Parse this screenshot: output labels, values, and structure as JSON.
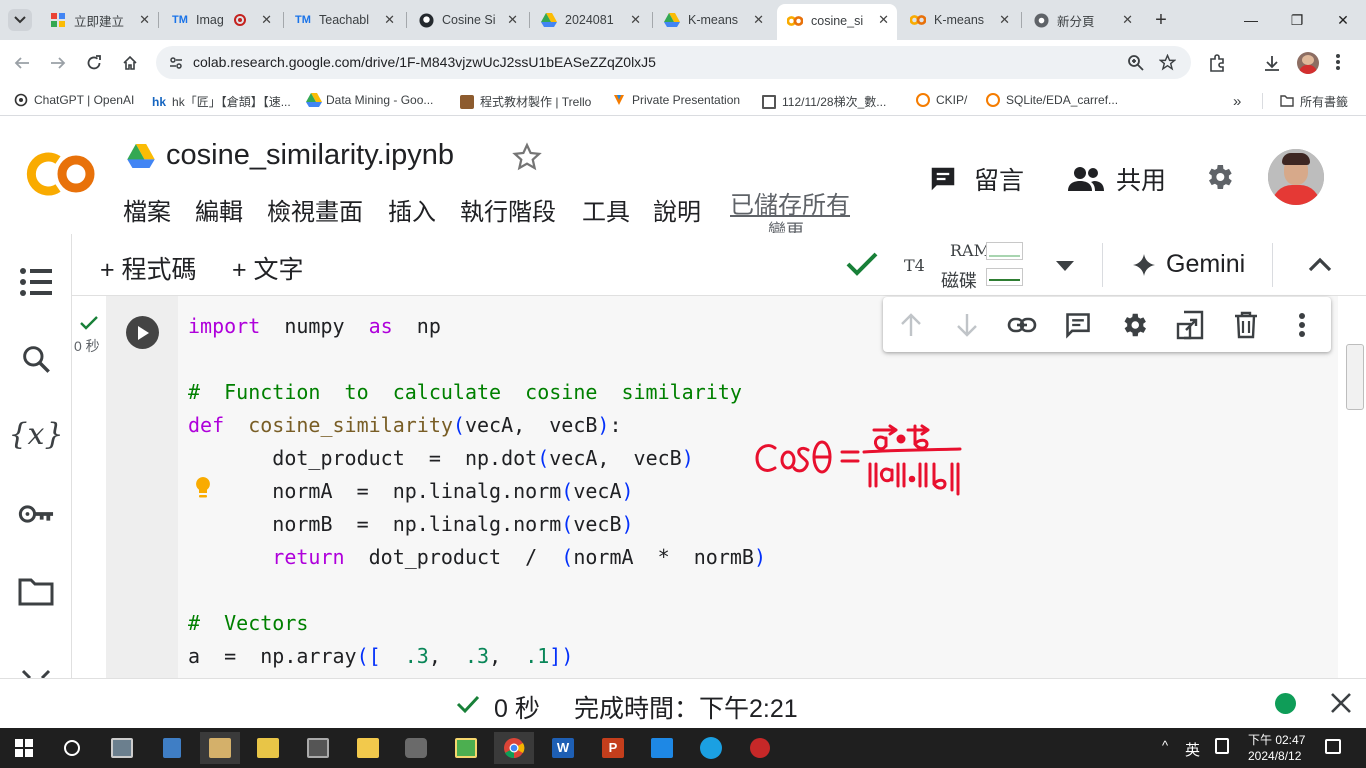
{
  "browser": {
    "tabs": [
      {
        "title": "立即建立",
        "icon": "google-grid-icon"
      },
      {
        "title": "Imag",
        "icon": "teachable-machine-icon",
        "recording": true
      },
      {
        "title": "Teachabl",
        "icon": "teachable-machine-icon"
      },
      {
        "title": "Cosine Si",
        "icon": "github-icon"
      },
      {
        "title": "2024081",
        "icon": "google-drive-icon"
      },
      {
        "title": "K-means",
        "icon": "google-drive-icon"
      },
      {
        "title": "cosine_si",
        "icon": "colab-icon",
        "active": true
      },
      {
        "title": "K-means",
        "icon": "colab-icon"
      },
      {
        "title": "新分頁",
        "icon": "chrome-icon"
      }
    ],
    "url": "colab.research.google.com/drive/1F-M843vjzwUcJ2ssU1bEASeZZqZ0lxJ5",
    "bookmarks": [
      "ChatGPT | OpenAI",
      "hk「匠」【倉頡】【速...",
      "Data Mining - Goo...",
      "程式教材製作 | Trello",
      "Private Presentation",
      "112/11/28梯次_數...",
      "CKIP/",
      "SQLite/EDA_carref..."
    ],
    "all_bookmarks": "所有書籤"
  },
  "colab": {
    "notebook_title": "cosine_similarity.ipynb",
    "menu": [
      "檔案",
      "編輯",
      "檢視畫面",
      "插入",
      "執行階段",
      "工具",
      "說明"
    ],
    "saved_status": "已儲存所有",
    "saved_status_2": "變更",
    "comment": "留言",
    "share": "共用",
    "toolbar": {
      "add_code": "+ 程式碼",
      "add_text": "+ 文字",
      "runtime": "T4",
      "ram": "RAM",
      "disk": "磁碟",
      "gemini": "Gemini"
    },
    "cell": {
      "exec_time": "0 秒",
      "code_lines": [
        "import numpy as np",
        "",
        "# Function to calculate cosine similarity",
        "def cosine_similarity(vecA, vecB):",
        "    dot_product = np.dot(vecA, vecB)",
        "    normA = np.linalg.norm(vecA)",
        "    normB = np.linalg.norm(vecB)",
        "    return dot_product / (normA * normB)",
        "",
        "# Vectors",
        "a = np.array([ .3, .3, .1])"
      ]
    },
    "annotation": {
      "lhs": "Cosθ =",
      "numerator": "a • b",
      "denominator": "||a||·||b||",
      "color": "#e8102e"
    },
    "status": {
      "elapsed": "0 秒",
      "completed": "完成時間：下午2:21"
    }
  },
  "taskbar": {
    "ime": "英",
    "time": "下午 02:47",
    "date": "2024/8/12"
  },
  "colors": {
    "colab_orange": "#f9ab00",
    "keyword": "#af00db",
    "comment": "#008000",
    "function": "#795e26",
    "number": "#098658",
    "check_green": "#188038",
    "status_dot": "#0f9d58"
  }
}
